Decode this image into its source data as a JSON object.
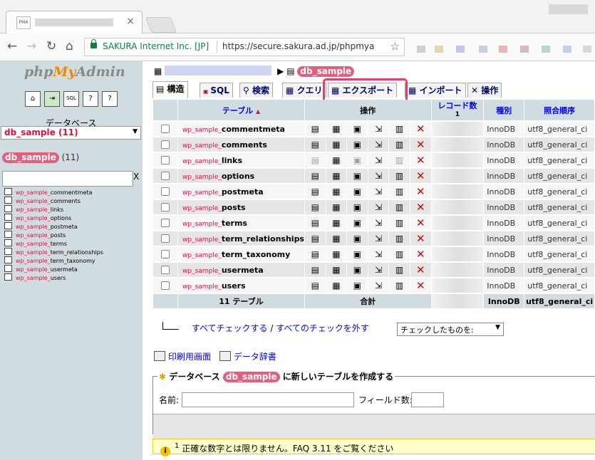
{
  "browser": {
    "tab_favicon": "PMA",
    "cert_label": "SAKURA Internet Inc. [JP]",
    "url": "https://secure.sakura.ad.jp/phpmya"
  },
  "sidebar": {
    "logo": {
      "p1": "php",
      "p2": "My",
      "p3": "Admin"
    },
    "db_label": "データベース",
    "db_select": "db_sample (11)",
    "db_name": "db_sample",
    "db_count": "(11)",
    "filter_clear": "X",
    "table_prefix": "wp_sample_",
    "tables": [
      "commentmeta",
      "comments",
      "links",
      "options",
      "postmeta",
      "posts",
      "terms",
      "term_relationships",
      "term_taxonomy",
      "usermeta",
      "users"
    ]
  },
  "breadcrumb": {
    "db": "db_sample"
  },
  "tabs": {
    "structure": "構造",
    "sql": "SQL",
    "search": "検索",
    "query": "クエリ",
    "export": "エクスポート",
    "import": "インポート",
    "operations": "操作"
  },
  "table": {
    "headers": {
      "table": "テーブル",
      "sort": "▲",
      "action": "操作",
      "records": "レコード数",
      "records_note": "1",
      "type": "種別",
      "collation": "照合順序"
    },
    "prefix": "wp_sample_",
    "rows": [
      {
        "name": "commentmeta",
        "engine": "InnoDB",
        "collation": "utf8_general_ci"
      },
      {
        "name": "comments",
        "engine": "InnoDB",
        "collation": "utf8_general_ci"
      },
      {
        "name": "links",
        "engine": "InnoDB",
        "collation": "utf8_general_ci"
      },
      {
        "name": "options",
        "engine": "InnoDB",
        "collation": "utf8_general_ci"
      },
      {
        "name": "postmeta",
        "engine": "InnoDB",
        "collation": "utf8_general_ci"
      },
      {
        "name": "posts",
        "engine": "InnoDB",
        "collation": "utf8_general_ci"
      },
      {
        "name": "terms",
        "engine": "InnoDB",
        "collation": "utf8_general_ci"
      },
      {
        "name": "term_relationships",
        "engine": "InnoDB",
        "collation": "utf8_general_ci"
      },
      {
        "name": "term_taxonomy",
        "engine": "InnoDB",
        "collation": "utf8_general_ci"
      },
      {
        "name": "usermeta",
        "engine": "InnoDB",
        "collation": "utf8_general_ci"
      },
      {
        "name": "users",
        "engine": "InnoDB",
        "collation": "utf8_general_ci"
      }
    ],
    "summary": {
      "tables": "11 テーブル",
      "total": "合計",
      "engine": "InnoDB",
      "collation": "utf8_general_ci"
    }
  },
  "bulk": {
    "check_all": "すべてチェックする",
    "separator": "/",
    "uncheck_all": "すべてのチェックを外す",
    "with_selected": "チェックしたものを:"
  },
  "links": {
    "print": "印刷用画面",
    "dictionary": "データ辞書"
  },
  "create": {
    "legend_pre": "データベース",
    "legend_db": "db_sample",
    "legend_post": "に新しいテーブルを作成する",
    "name_label": "名前:",
    "fields_label": "フィールド数:"
  },
  "notice": {
    "sup": "1",
    "text": "正確な数字とは限りません。FAQ 3.11 をご覧ください"
  }
}
